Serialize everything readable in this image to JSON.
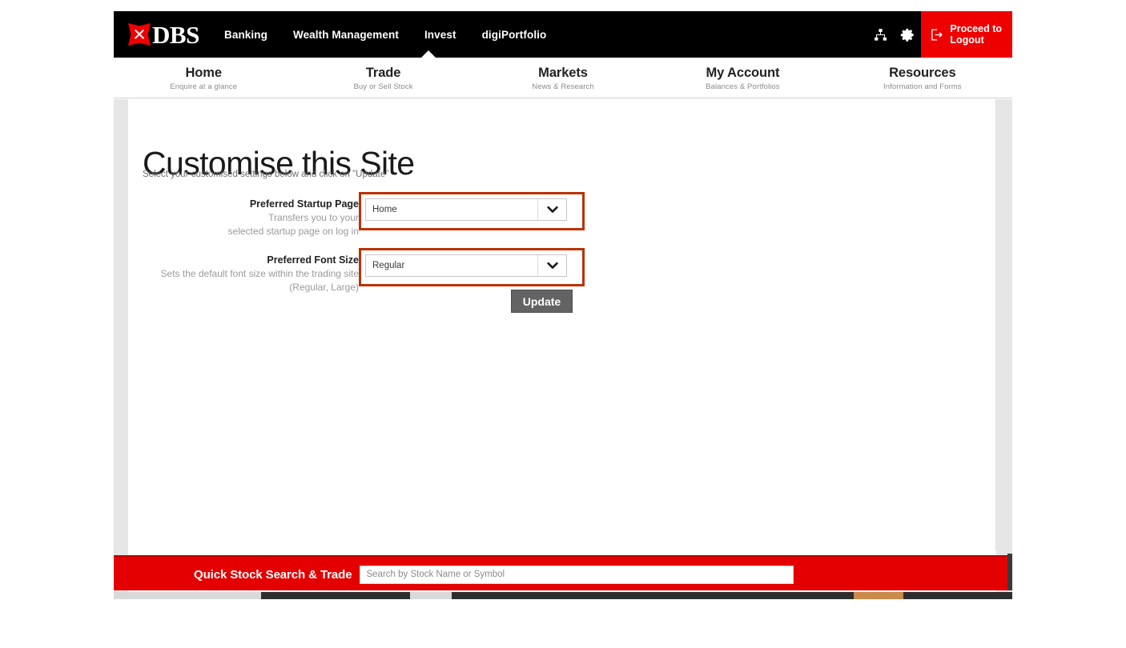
{
  "brand": {
    "name": "DBS",
    "logo_icon": "dbs-diamond-logo",
    "accent_red": "#ee0000",
    "highlight_red": "#bb3205",
    "bar_red": "#e40000"
  },
  "header": {
    "nav": [
      {
        "label": "Banking",
        "active": false
      },
      {
        "label": "Wealth Management",
        "active": false
      },
      {
        "label": "Invest",
        "active": true
      },
      {
        "label": "digiPortfolio",
        "active": false
      }
    ],
    "tools": [
      {
        "icon": "sitemap-icon",
        "name": "sitemap"
      },
      {
        "icon": "gear-icon",
        "name": "settings"
      }
    ],
    "logout": {
      "icon": "logout-arrow-icon",
      "line1": "Proceed to",
      "line2": "Logout"
    }
  },
  "subnav": {
    "items": [
      {
        "title": "Home",
        "subtitle": "Enquire at a glance"
      },
      {
        "title": "Trade",
        "subtitle": "Buy or Sell Stock"
      },
      {
        "title": "Markets",
        "subtitle": "News & Research"
      },
      {
        "title": "My Account",
        "subtitle": "Balances & Portfolios"
      },
      {
        "title": "Resources",
        "subtitle": "Information and Forms"
      }
    ]
  },
  "main": {
    "title": "Customise this Site",
    "subtitle": "Select your customised settings below and click on \"Update\"",
    "fields": [
      {
        "label": "Preferred Startup Page",
        "hint_line1": "Transfers you to your",
        "hint_line2": "selected startup page on log in",
        "hint_line3": "",
        "value": "Home",
        "highlighted": true,
        "dropdown_icon": "chevron-down-icon"
      },
      {
        "label": "Preferred Font Size",
        "hint_line1": "Sets the default font size within the trading site",
        "hint_line2": "(Regular, Large)",
        "hint_line3": "",
        "value": "Regular",
        "highlighted": true,
        "dropdown_icon": "chevron-down-icon"
      }
    ],
    "update_label": "Update"
  },
  "footer_search": {
    "label": "Quick Stock Search & Trade",
    "placeholder": "Search by Stock Name or Symbol",
    "value": ""
  }
}
